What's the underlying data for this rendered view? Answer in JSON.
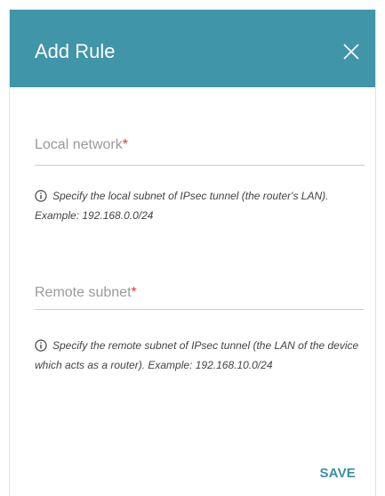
{
  "dialog": {
    "title": "Add Rule",
    "close_icon": "close-icon",
    "local_network": {
      "label": "Local network",
      "required_mark": "*",
      "hint": "Specify the local subnet of IPsec tunnel (the router's LAN). Example: 192.168.0.0/24",
      "hint_icon": "info-icon"
    },
    "remote_subnet": {
      "label": "Remote subnet",
      "required_mark": "*",
      "hint": "Specify the remote subnet of IPsec tunnel (the LAN of the device which acts as a router). Example: 192.168.10.0/24",
      "hint_icon": "info-icon"
    },
    "save_label": "SAVE"
  },
  "colors": {
    "header_bg": "#4095a9",
    "accent": "#3a8fa3",
    "required": "#e2362d"
  }
}
